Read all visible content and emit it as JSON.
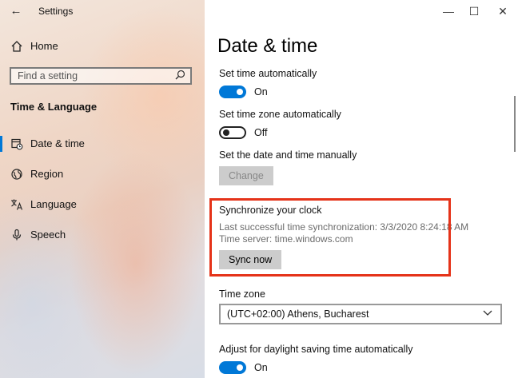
{
  "window": {
    "title": "Settings",
    "back_icon": "←",
    "minimize": "—",
    "maximize": "☐",
    "close": "✕"
  },
  "sidebar": {
    "home": "Home",
    "search_placeholder": "Find a setting",
    "section": "Time & Language",
    "items": [
      {
        "label": "Date & time",
        "icon": "date-time-icon",
        "selected": true
      },
      {
        "label": "Region",
        "icon": "region-icon",
        "selected": false
      },
      {
        "label": "Language",
        "icon": "language-icon",
        "selected": false
      },
      {
        "label": "Speech",
        "icon": "speech-icon",
        "selected": false
      }
    ]
  },
  "main": {
    "title": "Date & time",
    "set_time_auto": {
      "label": "Set time automatically",
      "state": "On"
    },
    "set_zone_auto": {
      "label": "Set time zone automatically",
      "state": "Off"
    },
    "manual": {
      "label": "Set the date and time manually",
      "button": "Change"
    },
    "sync": {
      "heading": "Synchronize your clock",
      "last_sync": "Last successful time synchronization: 3/3/2020 8:24:18 AM",
      "server": "Time server: time.windows.com",
      "button": "Sync now"
    },
    "time_zone": {
      "label": "Time zone",
      "value": "(UTC+02:00) Athens, Bucharest"
    },
    "dst": {
      "label": "Adjust for daylight saving time automatically",
      "state": "On"
    }
  },
  "colors": {
    "accent": "#0078d7",
    "highlight": "#e53319"
  }
}
